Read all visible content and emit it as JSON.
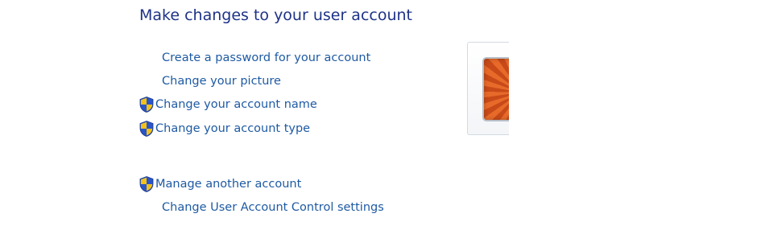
{
  "header": {
    "title": "Make changes to your user account"
  },
  "tasks": [
    {
      "label": "Create a password for your account",
      "shield": false
    },
    {
      "label": "Change your picture",
      "shield": false
    },
    {
      "label": "Change your account name",
      "shield": true
    },
    {
      "label": "Change your account type",
      "shield": true
    }
  ],
  "more_tasks": [
    {
      "label": "Manage another account",
      "shield": true
    },
    {
      "label": "Change User Account Control settings",
      "shield": false
    }
  ],
  "icons": {
    "admin_shield": "uac-shield-icon"
  },
  "colors": {
    "title": "#1e3287",
    "link": "#1e5aa3",
    "shield_blue": "#2a55c8",
    "shield_yellow": "#f2c21b"
  }
}
